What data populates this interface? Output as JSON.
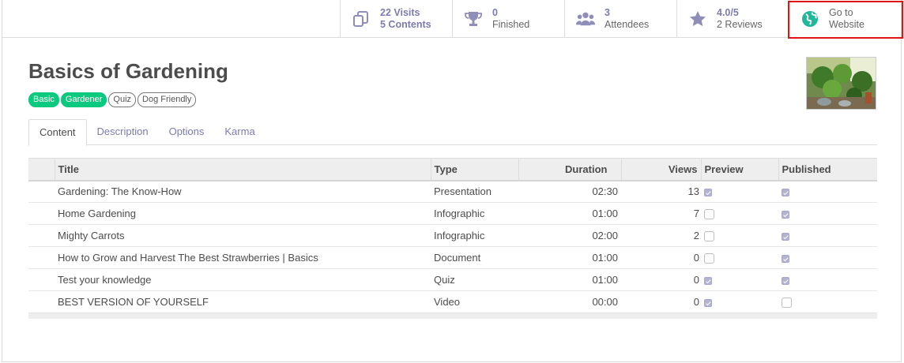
{
  "stats": {
    "visits": {
      "value": "22 Visits",
      "sub": "5 Contents",
      "icon": "copy-icon"
    },
    "finished": {
      "value": "0",
      "label": "Finished",
      "icon": "trophy-icon"
    },
    "attendees": {
      "value": "3",
      "label": "Attendees",
      "icon": "users-icon"
    },
    "reviews": {
      "value": "4.0/5",
      "label": "2 Reviews",
      "icon": "star-icon"
    },
    "website": {
      "line1": "Go to",
      "line2": "Website",
      "icon": "globe-icon"
    }
  },
  "course": {
    "title": "Basics of Gardening",
    "tags": [
      {
        "label": "Basic",
        "style": "filled"
      },
      {
        "label": "Gardener",
        "style": "filled"
      },
      {
        "label": "Quiz",
        "style": "outline"
      },
      {
        "label": "Dog Friendly",
        "style": "outline"
      }
    ]
  },
  "tabs": [
    "Content",
    "Description",
    "Options",
    "Karma"
  ],
  "table": {
    "headers": {
      "title": "Title",
      "type": "Type",
      "duration": "Duration",
      "views": "Views",
      "preview": "Preview",
      "published": "Published"
    },
    "rows": [
      {
        "title": "Gardening: The Know-How",
        "type": "Presentation",
        "duration": "02:30",
        "views": "13",
        "preview": true,
        "published": true
      },
      {
        "title": "Home Gardening",
        "type": "Infographic",
        "duration": "01:00",
        "views": "7",
        "preview": false,
        "published": true
      },
      {
        "title": "Mighty Carrots",
        "type": "Infographic",
        "duration": "02:00",
        "views": "2",
        "preview": false,
        "published": true
      },
      {
        "title": "How to Grow and Harvest The Best Strawberries | Basics",
        "type": "Document",
        "duration": "01:00",
        "views": "0",
        "preview": false,
        "published": true
      },
      {
        "title": "Test your knowledge",
        "type": "Quiz",
        "duration": "01:00",
        "views": "0",
        "preview": true,
        "published": true
      },
      {
        "title": "BEST VERSION OF YOURSELF",
        "type": "Video",
        "duration": "00:00",
        "views": "0",
        "preview": true,
        "published": false
      }
    ]
  },
  "colors": {
    "accent": "#7c7bad",
    "tag_green": "#0bc97f",
    "globe_green": "#21b799",
    "highlight": "#e01414"
  }
}
